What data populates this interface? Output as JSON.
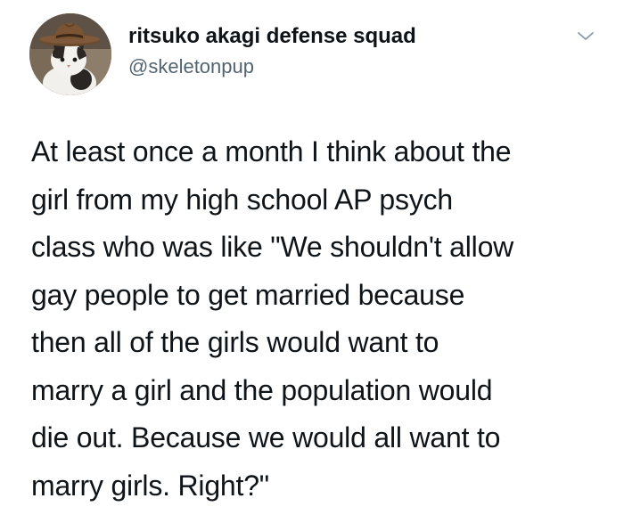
{
  "tweet": {
    "display_name": "ritsuko akagi defense squad",
    "handle": "@skeletonpup",
    "avatar_icon": "cat-wearing-cowboy-hat-avatar",
    "menu_icon": "chevron-down-icon",
    "text_lines": [
      "At least once a month I think about the",
      "girl from my high school AP psych",
      "class who was like \"We shouldn't allow",
      "gay people to get married because",
      "then all of the girls would want to",
      "marry a girl and the population would",
      "die out. Because we would all want to",
      "marry girls. Right?\""
    ]
  },
  "colors": {
    "background": "#ffffff",
    "text_primary": "#0f1419",
    "text_secondary": "#536471",
    "chevron": "#8b98a5"
  }
}
